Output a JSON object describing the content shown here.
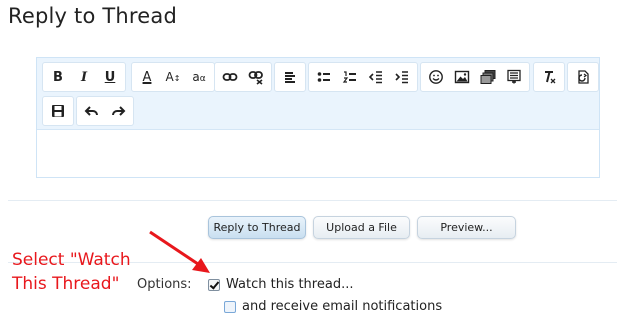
{
  "page": {
    "title": "Reply to Thread"
  },
  "editor": {
    "toolbar_row1": [
      {
        "group": "text-style",
        "buttons": [
          "bold-icon",
          "italic-icon",
          "underline-icon"
        ]
      },
      {
        "group": "font",
        "buttons": [
          "text-color-icon",
          "font-size-icon",
          "font-family-icon"
        ]
      },
      {
        "group": "links",
        "buttons": [
          "link-icon",
          "unlink-icon"
        ]
      },
      {
        "group": "align",
        "buttons": [
          "align-left-icon"
        ]
      },
      {
        "group": "lists",
        "buttons": [
          "bullet-list-icon",
          "numbered-list-icon",
          "outdent-icon",
          "indent-icon"
        ]
      },
      {
        "group": "insert",
        "buttons": [
          "smilie-icon",
          "image-icon",
          "media-icon",
          "code-icon"
        ]
      },
      {
        "group": "format",
        "buttons": [
          "remove-format-icon"
        ]
      },
      {
        "group": "toggle",
        "buttons": [
          "bbcode-toggle-icon"
        ]
      }
    ],
    "toolbar_row2": [
      {
        "group": "save",
        "buttons": [
          "save-draft-icon"
        ]
      },
      {
        "group": "history",
        "buttons": [
          "undo-icon",
          "redo-icon"
        ]
      }
    ],
    "glyphs": {
      "bold": "B",
      "italic": "I",
      "underline": "U",
      "text_color": "A",
      "font_size": "A",
      "font_family": "a"
    },
    "content": ""
  },
  "buttons": {
    "reply": "Reply to Thread",
    "upload": "Upload a File",
    "preview": "Preview..."
  },
  "annotation": {
    "line1": "Select \"Watch",
    "line2": "This Thread\"",
    "color": "#e8171c"
  },
  "options": {
    "label": "Options:",
    "watch_thread": {
      "label": "Watch this thread...",
      "checked": true
    },
    "email_notifications": {
      "label": "and receive email notifications",
      "checked": false
    }
  },
  "colors": {
    "toolbar_bg": "#eaf4fd",
    "primary_button": "#c9dff0"
  }
}
